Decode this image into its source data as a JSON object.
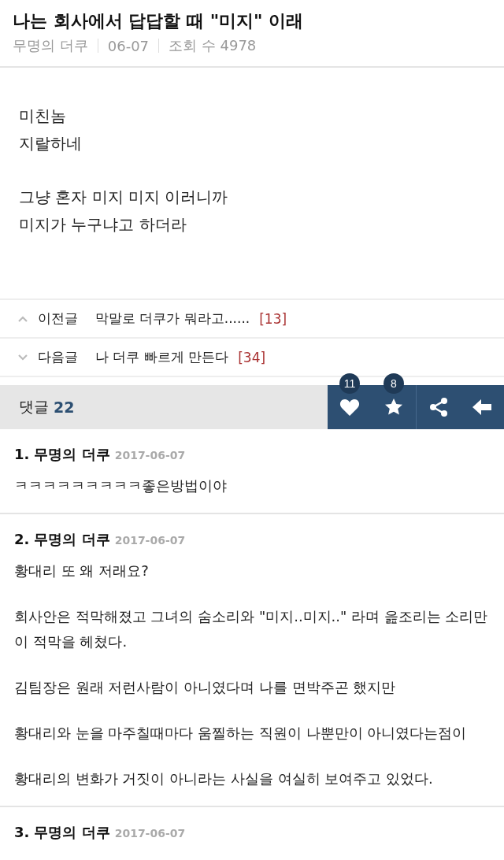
{
  "post": {
    "title": "나는 회사에서 답답할 때 \"미지\" 이래",
    "author": "무명의 더쿠",
    "date": "06-07",
    "views": "조회 수 4978",
    "paragraphs": [
      [
        "미친놈",
        "지랄하네"
      ],
      [
        "그냥 혼자 미지 미지 이러니까",
        "미지가 누구냐고 하더라"
      ]
    ]
  },
  "nav": [
    {
      "kind": "prev",
      "label": "이전글",
      "title": "막말로 더쿠가 뭐라고......",
      "count": "[13]"
    },
    {
      "kind": "next",
      "label": "다음글",
      "title": "나 더쿠 빠르게 만든다",
      "count": "[34]"
    }
  ],
  "comment_bar": {
    "label": "댓글",
    "count": "22",
    "actions": [
      {
        "kind": "like",
        "badge": "11"
      },
      {
        "kind": "favorite",
        "badge": "8"
      },
      {
        "kind": "share"
      },
      {
        "kind": "back"
      }
    ]
  },
  "comments": [
    {
      "number": "1.",
      "author": "무명의 더쿠",
      "date": "2017-06-07",
      "paragraphs": [
        "ㅋㅋㅋㅋㅋㅋㅋㅋㅋ좋은방법이야"
      ]
    },
    {
      "number": "2.",
      "author": "무명의 더쿠",
      "date": "2017-06-07",
      "paragraphs": [
        "황대리 또 왜 저래요?",
        "회사안은 적막해졌고 그녀의 숨소리와 \"미지..미지..\" 라며 읊조리는 소리만이 적막을 헤쳤다.",
        "김팀장은 원래 저런사람이 아니였다며 나를 면박주곤 했지만",
        "황대리와 눈을 마주칠때마다 움찔하는 직원이 나뿐만이 아니였다는점이",
        "황대리의 변화가 거짓이 아니라는 사실을 여실히 보여주고 있었다."
      ]
    },
    {
      "number": "3.",
      "author": "무명의 더쿠",
      "date": "2017-06-07"
    }
  ]
}
